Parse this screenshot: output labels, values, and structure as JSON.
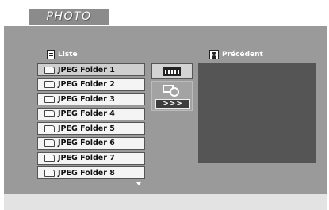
{
  "title": "PHOTO",
  "list": {
    "header_label": "Liste",
    "header_icon": "list-icon",
    "items": [
      {
        "label": "JPEG Folder 1",
        "selected": true
      },
      {
        "label": "JPEG Folder 2",
        "selected": false
      },
      {
        "label": "JPEG Folder 3",
        "selected": false
      },
      {
        "label": "JPEG Folder 4",
        "selected": false
      },
      {
        "label": "JPEG Folder 5",
        "selected": false
      },
      {
        "label": "JPEG Folder 6",
        "selected": false
      },
      {
        "label": "JPEG Folder 7",
        "selected": false
      },
      {
        "label": "JPEG Folder 8",
        "selected": false
      }
    ],
    "more_indicator_icon": "arrow-down-icon"
  },
  "controls": {
    "mode_icon": "film-strip-icon",
    "slideshow_icon": "slideshow-icon",
    "next_label": ">>>"
  },
  "preview": {
    "header_label": "Précédent",
    "header_icon": "person-icon"
  },
  "colors": {
    "panel": "#9a9a9a",
    "item_bg": "#f4f4f4",
    "preview_bg": "#555555",
    "title_bg": "#8b8b8b"
  }
}
